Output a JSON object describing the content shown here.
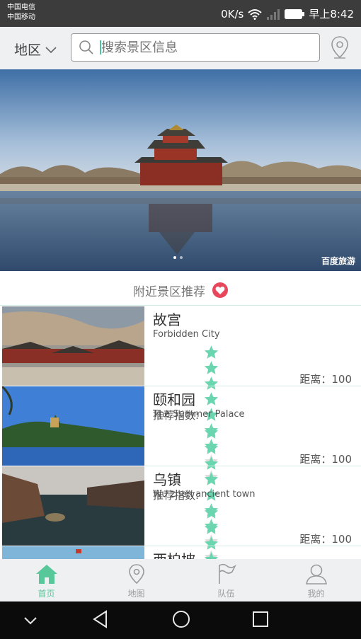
{
  "status_bar": {
    "carrier_1": "中国电信",
    "carrier_2": "中国移动",
    "speed": "0K/s",
    "time": "早上8:42"
  },
  "header": {
    "region_label": "地区",
    "search_placeholder": "搜索景区信息"
  },
  "banner": {
    "watermark": "百度旅游",
    "slide_count": 2,
    "active_slide": 1
  },
  "section": {
    "title": "附近景区推荐"
  },
  "rating_label": "推荐指数:",
  "distance_label": "距离：",
  "star_colors": {
    "filled": "#6ad6b0",
    "empty": "#dcdcdc"
  },
  "places": [
    {
      "name": "故宫",
      "english": "Forbidden City",
      "stars": 7,
      "max_stars": 9,
      "distance": "100"
    },
    {
      "name": "颐和园",
      "english": "The Summer Palace",
      "stars": 7,
      "max_stars": 9,
      "distance": "100"
    },
    {
      "name": "乌镇",
      "english": "Wu zhen ancient town",
      "stars": 4.5,
      "max_stars": 9,
      "distance": "100"
    },
    {
      "name": "西柏坡",
      "english": "",
      "stars": 0,
      "max_stars": 9,
      "distance": ""
    }
  ],
  "tabs": [
    {
      "label": "首页",
      "icon": "home-icon",
      "active": true
    },
    {
      "label": "地图",
      "icon": "map-pin-icon",
      "active": false
    },
    {
      "label": "队伍",
      "icon": "flag-icon",
      "active": false
    },
    {
      "label": "我的",
      "icon": "user-icon",
      "active": false
    }
  ],
  "accent_color": "#58c89b"
}
